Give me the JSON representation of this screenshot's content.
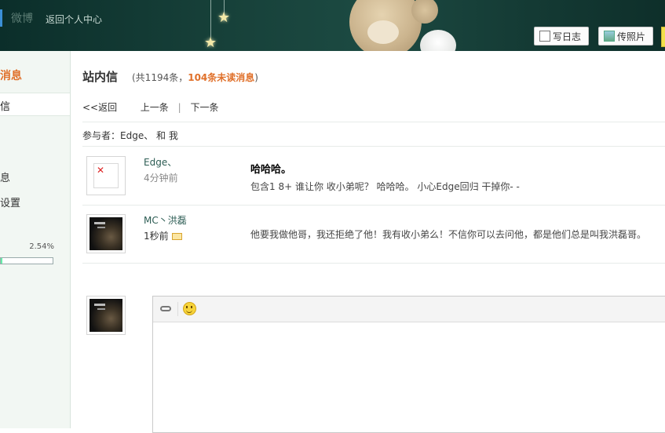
{
  "header": {
    "brand": "微博",
    "back_link": "返回个人中心",
    "buttons": [
      {
        "label": "写日志",
        "icon": "pencil-doc-icon"
      },
      {
        "label": "传照片",
        "icon": "photo-icon"
      }
    ]
  },
  "sidebar": {
    "category": "消息",
    "active_item": "信",
    "items": [
      "息",
      "设置"
    ],
    "storage_percent_text": "2.54%",
    "storage_fraction": 0.0254
  },
  "page": {
    "title": "站内信",
    "meta_prefix": "(共1194条，",
    "unread_text": "104条未读消息",
    "meta_suffix": ")"
  },
  "nav": {
    "back": "<<返回",
    "prev": "上一条",
    "separator": "|",
    "next": "下一条"
  },
  "participants": "参与者：Edge、 和 我",
  "messages": [
    {
      "sender": "Edge、",
      "time": "4分钟前",
      "subject": "哈哈哈。",
      "body": "包含1 8+  谁让你 收小弟呢？    哈哈哈。 小心Edge回归  干掉你- -",
      "avatar": "broken-image-icon"
    },
    {
      "sender": "MC丶洪磊",
      "time": "1秒前",
      "subject": "",
      "body": "他要我做他哥，我还拒绝了他！我有收小弟么！不信你可以去问他，都是他们总是叫我洪磊哥。",
      "avatar": "wolf-avatar",
      "unread_icon": "envelope-icon"
    }
  ],
  "composer": {
    "toolbar": [
      "link-icon",
      "smiley-icon"
    ]
  },
  "colors": {
    "accent": "#e0702a",
    "sidebar_bg": "#f2f7f3",
    "header_bg": "#163f38"
  }
}
